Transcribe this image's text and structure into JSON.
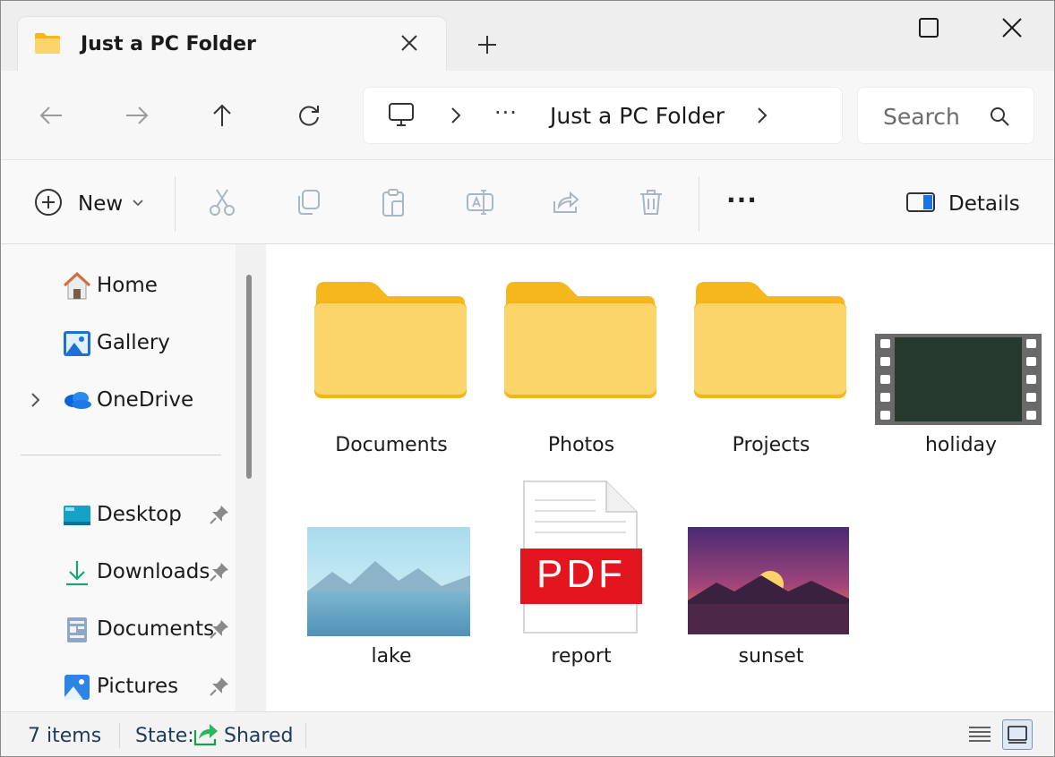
{
  "window": {
    "tab_title": "Just a PC Folder"
  },
  "navigation": {
    "address_more": "···",
    "address_current": "Just a PC Folder",
    "search_placeholder": "Search"
  },
  "toolbar": {
    "new_label": "New",
    "more_label": "···",
    "details_label": "Details"
  },
  "sidebar": {
    "top_items": [
      {
        "label": "Home",
        "icon": "home-icon"
      },
      {
        "label": "Gallery",
        "icon": "gallery-icon"
      },
      {
        "label": "OneDrive",
        "icon": "onedrive-icon"
      }
    ],
    "pinned_items": [
      {
        "label": "Desktop",
        "icon": "desktop-icon"
      },
      {
        "label": "Downloads",
        "icon": "download-icon"
      },
      {
        "label": "Documents",
        "icon": "documents-icon"
      },
      {
        "label": "Pictures",
        "icon": "pictures-icon"
      }
    ]
  },
  "content": {
    "items": [
      {
        "name": "Documents",
        "type": "folder"
      },
      {
        "name": "Photos",
        "type": "folder"
      },
      {
        "name": "Projects",
        "type": "folder"
      },
      {
        "name": "holiday",
        "type": "video"
      },
      {
        "name": "lake",
        "type": "image"
      },
      {
        "name": "report",
        "type": "pdf",
        "badge": "PDF"
      },
      {
        "name": "sunset",
        "type": "image"
      }
    ]
  },
  "status": {
    "item_count": "7 items",
    "state_label": "State:",
    "state_value": "Shared"
  },
  "colors": {
    "folder_body": "#fbd56a",
    "folder_back": "#f5b71c",
    "pdf_red": "#e3161f",
    "accent_blue": "#1a73e8"
  }
}
